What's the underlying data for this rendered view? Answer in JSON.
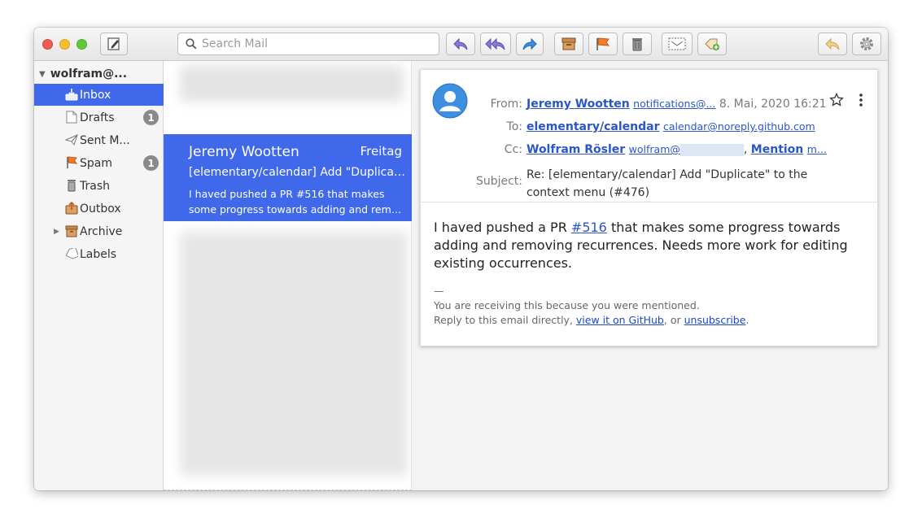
{
  "search": {
    "placeholder": "Search Mail"
  },
  "toolbar": {
    "icons": [
      "compose-icon",
      "reply-icon",
      "reply-all-icon",
      "forward-icon",
      "archive-icon",
      "junk-flag-icon",
      "trash-icon",
      "move-icon",
      "label-add-icon",
      "undo-icon",
      "settings-icon"
    ]
  },
  "sidebar": {
    "account": "wolfram@...",
    "folders": [
      {
        "label": "Inbox",
        "badge": ""
      },
      {
        "label": "Drafts",
        "badge": "1"
      },
      {
        "label": "Sent M...",
        "badge": ""
      },
      {
        "label": "Spam",
        "badge": "1"
      },
      {
        "label": "Trash",
        "badge": ""
      },
      {
        "label": "Outbox",
        "badge": ""
      },
      {
        "label": "Archive",
        "badge": ""
      },
      {
        "label": "Labels",
        "badge": ""
      }
    ]
  },
  "conversation": {
    "sender": "Jeremy Wootten",
    "date": "Freitag",
    "subject": "[elementary/calendar] Add \"Duplicat...",
    "preview_line1": "I haved pushed a PR #516 that makes",
    "preview_line2": "some progress towards adding and remo..."
  },
  "message": {
    "from_label": "From:",
    "from_name": "Jeremy Wootten",
    "from_address": "notifications@...",
    "date": "8. Mai, 2020 16:21",
    "to_label": "To:",
    "to_name": "elementary/calendar",
    "to_address": "calendar@noreply.github.com",
    "cc_label": "Cc:",
    "cc_name": "Wolfram Rösler",
    "cc_address": "wolfram@",
    "cc_sep": ",",
    "cc_name2": "Mention",
    "cc_address2": "m...",
    "subject_label": "Subject:",
    "subject_line1": "Re: [elementary/calendar] Add \"Duplicate\" to the",
    "subject_line2": "context menu (#476)",
    "body_pre": "I haved pushed a PR ",
    "body_link": "#516",
    "body_post": " that makes some progress towards adding and removing recurrences. Needs more work for editing existing occurrences.",
    "sig_dash": "—",
    "sig_line1": "You are receiving this because you were mentioned.",
    "sig_line2_pre": "Reply to this email directly, ",
    "sig_link1": "view it on GitHub",
    "sig_mid": ", or ",
    "sig_link2": "unsubscribe",
    "sig_end": "."
  },
  "colors": {
    "accent": "#3f69ea",
    "link": "#2a56c6"
  }
}
